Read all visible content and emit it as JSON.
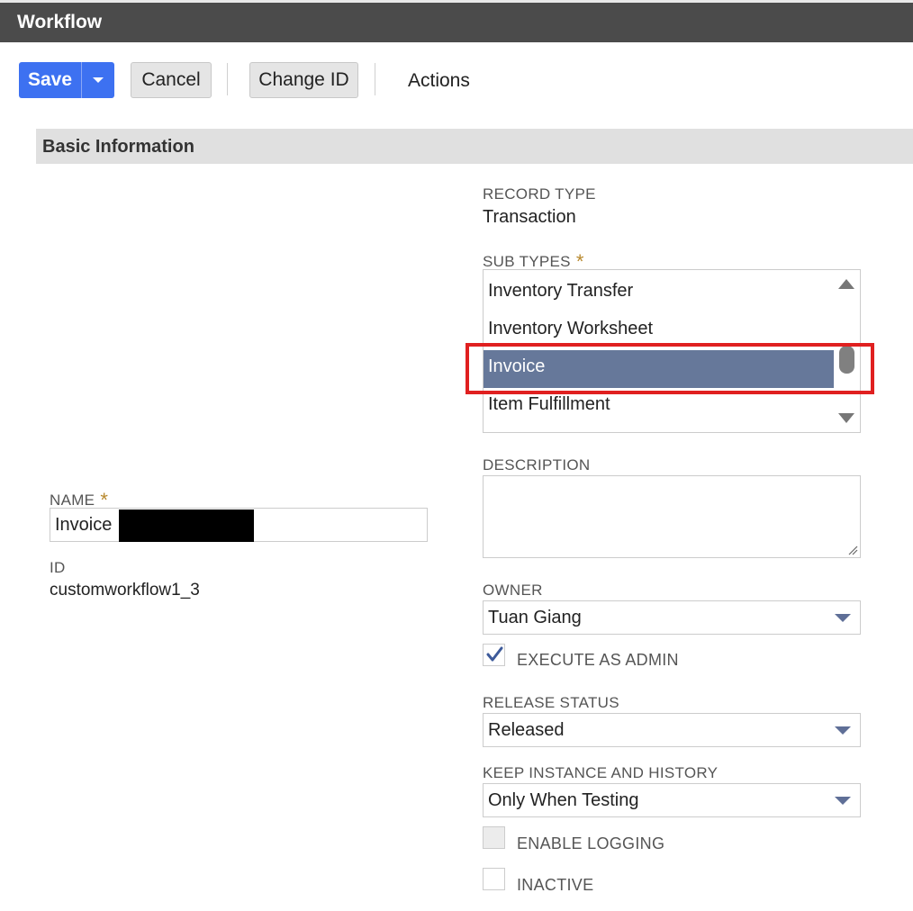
{
  "window": {
    "title": "Workflow"
  },
  "toolbar": {
    "save_label": "Save",
    "cancel_label": "Cancel",
    "change_id_label": "Change ID",
    "actions_label": "Actions"
  },
  "section": {
    "title": "Basic Information"
  },
  "name_field": {
    "label": "NAME",
    "required_mark": "*",
    "value": "Invoice"
  },
  "id_field": {
    "label": "ID",
    "value": "customworkflow1_3"
  },
  "record_type": {
    "label": "RECORD TYPE",
    "value": "Transaction"
  },
  "sub_types": {
    "label": "SUB TYPES",
    "required_mark": "*",
    "items": [
      "Inventory Transfer",
      "Inventory Worksheet",
      "Invoice",
      "Item Fulfillment"
    ],
    "selected": "Invoice"
  },
  "description": {
    "label": "DESCRIPTION",
    "value": ""
  },
  "owner": {
    "label": "OWNER",
    "value": "Tuan Giang"
  },
  "execute_as_admin": {
    "label": "EXECUTE AS ADMIN",
    "checked": true
  },
  "release_status": {
    "label": "RELEASE STATUS",
    "value": "Released"
  },
  "keep_instance": {
    "label": "KEEP INSTANCE AND HISTORY",
    "value": "Only When Testing"
  },
  "enable_logging": {
    "label": "ENABLE LOGGING",
    "checked": false
  },
  "inactive": {
    "label": "INACTIVE",
    "checked": false
  },
  "colors": {
    "primary_button": "#3d71f1",
    "title_bar": "#4b4b4b",
    "selected_item": "#66789a",
    "highlight_box": "#e02020",
    "required_mark": "#b8892e"
  }
}
